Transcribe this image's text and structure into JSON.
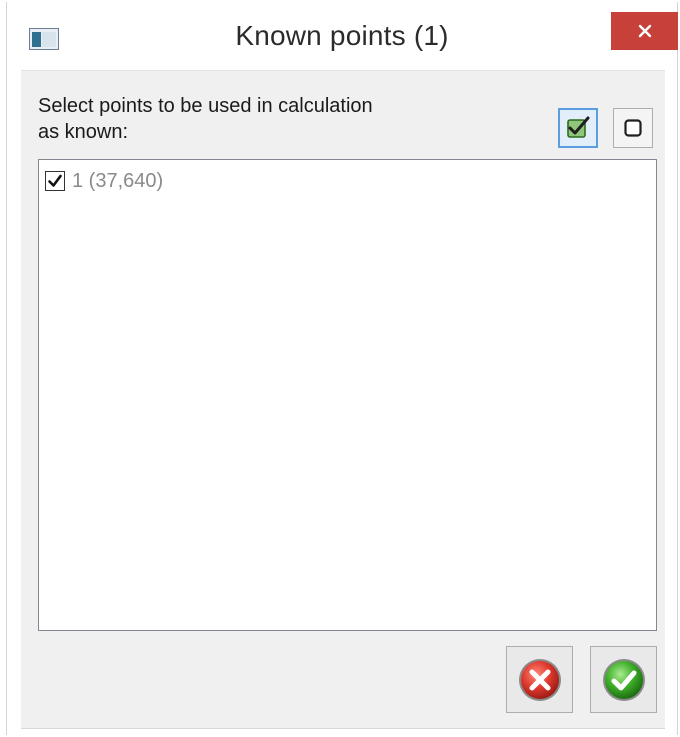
{
  "window": {
    "title": "Known points (1)",
    "icons": {
      "app": "window-icon",
      "close": "close-icon"
    }
  },
  "dialog": {
    "prompt_line1": "Select points to be used in calculation",
    "prompt_line2": "as known:",
    "toolbar": {
      "check_all_icon": "check-all-icon",
      "uncheck_all_icon": "uncheck-all-icon"
    },
    "points": [
      {
        "label": "1 (37,640)",
        "checked": true
      }
    ],
    "buttons": {
      "cancel_icon": "cancel-icon",
      "ok_icon": "ok-icon"
    }
  },
  "colors": {
    "close_button": "#c7403a",
    "client_background": "#f0f0f0",
    "selected_tool_border": "#5a9ee0",
    "cancel_red": "#e03a2f",
    "ok_green": "#3fae2a",
    "disabled_text": "#8a8a8a"
  }
}
